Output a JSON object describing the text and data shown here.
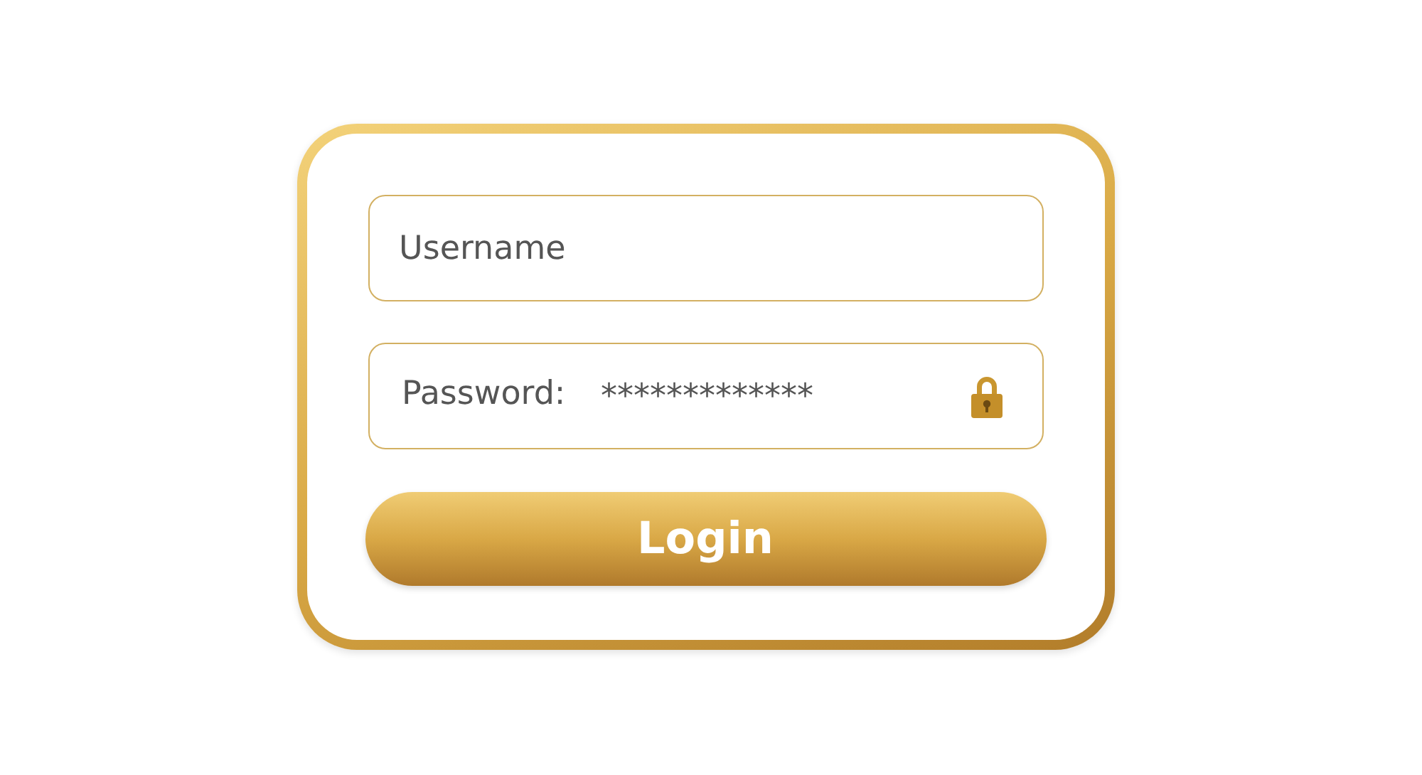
{
  "username_field": {
    "placeholder": "Username"
  },
  "password_field": {
    "label": "Password:",
    "value": "*************"
  },
  "login_button": {
    "label": "Login"
  }
}
